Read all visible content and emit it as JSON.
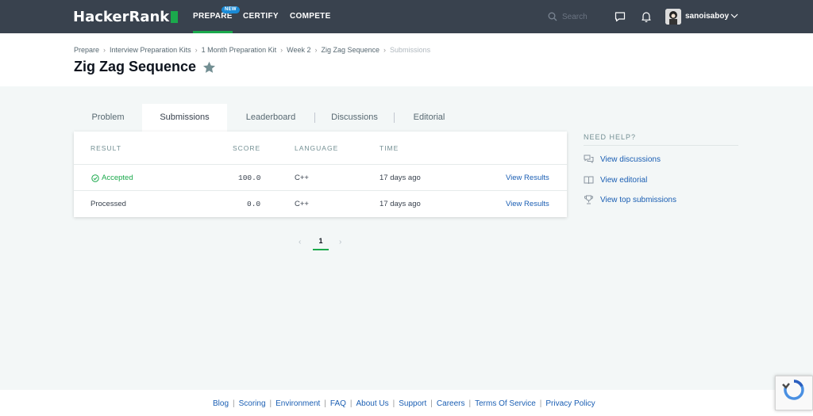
{
  "navbar": {
    "logo": "HackerRank",
    "items": [
      {
        "label": "PREPARE",
        "badge": "NEW"
      },
      {
        "label": "CERTIFY"
      },
      {
        "label": "COMPETE"
      }
    ],
    "search_placeholder": "Search",
    "username": "sanoisaboy"
  },
  "breadcrumb": [
    "Prepare",
    "Interview Preparation Kits",
    "1 Month Preparation Kit",
    "Week 2",
    "Zig Zag Sequence",
    "Submissions"
  ],
  "page_title": "Zig Zag Sequence",
  "tabs": [
    {
      "label": "Problem"
    },
    {
      "label": "Submissions"
    },
    {
      "label": "Leaderboard"
    },
    {
      "label": "Discussions"
    },
    {
      "label": "Editorial"
    }
  ],
  "table": {
    "headers": [
      "RESULT",
      "SCORE",
      "LANGUAGE",
      "TIME"
    ],
    "rows": [
      {
        "result": "Accepted",
        "score": "100.0",
        "language": "C++",
        "time": "17 days ago",
        "action": "View Results"
      },
      {
        "result": "Processed",
        "score": "0.0",
        "language": "C++",
        "time": "17 days ago",
        "action": "View Results"
      }
    ]
  },
  "pagination": {
    "current": "1",
    "prev": "‹",
    "next": "›"
  },
  "help": {
    "title": "NEED HELP?",
    "links": [
      {
        "label": "View discussions",
        "icon": "chat-bubbles-icon"
      },
      {
        "label": "View editorial",
        "icon": "book-icon"
      },
      {
        "label": "View top submissions",
        "icon": "trophy-icon"
      }
    ]
  },
  "footer": {
    "links": [
      "Blog",
      "Scoring",
      "Environment",
      "FAQ",
      "About Us",
      "Support",
      "Careers",
      "Terms Of Service",
      "Privacy Policy"
    ]
  },
  "colors": {
    "navbar_bg": "#39424e",
    "accent_green": "#1ba94c",
    "link_blue": "#1a5eb3",
    "page_bg": "#f3f7f7"
  }
}
